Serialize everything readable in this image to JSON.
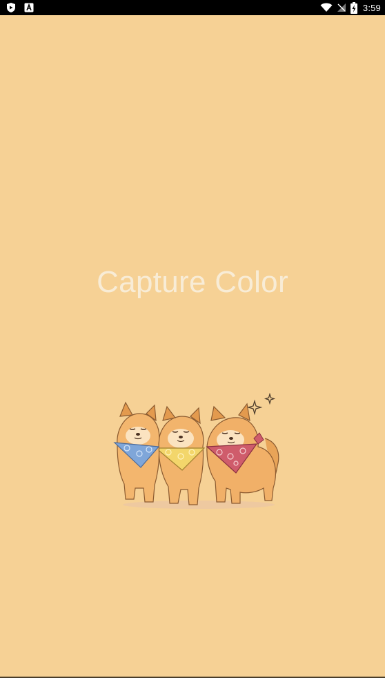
{
  "status_bar": {
    "time": "3:59",
    "icons": [
      "shield-icon",
      "a-badge-icon",
      "wifi-icon",
      "no-signal-icon",
      "battery-charging-icon"
    ]
  },
  "splash": {
    "title": "Capture Color",
    "illustration": "three-shiba-dogs-with-bandanas"
  },
  "colors": {
    "background": "#f6d195",
    "title": "#f8ecd6",
    "status_bar": "#000000",
    "bandana_blue": "#7fa6d9",
    "bandana_yellow": "#f3d66b",
    "bandana_red": "#cf5c6b"
  }
}
